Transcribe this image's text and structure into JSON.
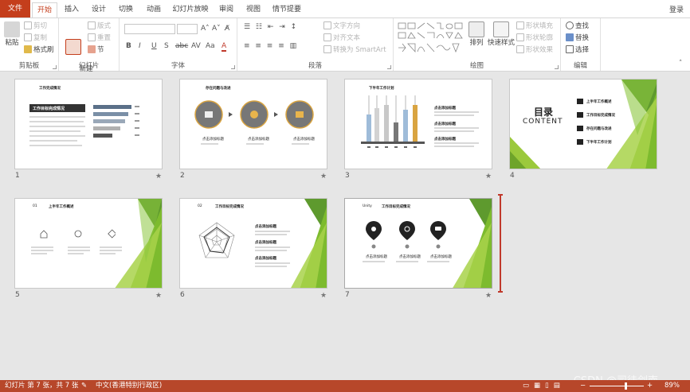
{
  "tabs": [
    "文件",
    "开始",
    "插入",
    "设计",
    "切换",
    "动画",
    "幻灯片放映",
    "审阅",
    "视图",
    "情节提要"
  ],
  "login": "登录",
  "ribbon": {
    "clipboard": {
      "paste": "粘贴",
      "cut": "剪切",
      "copy": "复制",
      "format_painter": "格式刷",
      "label": "剪贴板"
    },
    "slides": {
      "new_slide": "新建\n幻灯片",
      "layout": "版式",
      "reset": "重置",
      "section": "节",
      "label": "幻灯片"
    },
    "font": {
      "label": "字体",
      "buttons": [
        "B",
        "I",
        "U",
        "S",
        "abc",
        "AV",
        "Aa",
        "A"
      ]
    },
    "paragraph": {
      "text_direction": "文字方向",
      "align_text": "对齐文本",
      "smartart": "转换为 SmartArt",
      "label": "段落"
    },
    "drawing": {
      "arrange": "排列",
      "quick_styles": "快速样式",
      "shape_fill": "形状填充",
      "shape_outline": "形状轮廓",
      "shape_effects": "形状效果",
      "label": "绘图"
    },
    "editing": {
      "find": "查找",
      "replace": "替换",
      "select": "选择",
      "label": "编辑"
    }
  },
  "slides": [
    {
      "num": "1",
      "title": "工作完成情况",
      "subtitle": "工作目标完成情况"
    },
    {
      "num": "2",
      "title": "存在问题与改进",
      "captions": [
        "点击添加标题",
        "点击添加标题",
        "点击添加标题"
      ]
    },
    {
      "num": "3",
      "title": "下半年工作计划",
      "side_titles": [
        "点击添加标题",
        "点击添加标题",
        "点击添加标题"
      ]
    },
    {
      "num": "4",
      "toc_title": "目录",
      "toc_sub": "CONTENT",
      "items": [
        "上半年工作概述",
        "工作目标完成情况",
        "存在问题与改进",
        "下半年工作计划"
      ]
    },
    {
      "num": "5",
      "title": "上半年工作概述",
      "corner": "01"
    },
    {
      "num": "6",
      "title": "工作目标完成情况",
      "corner": "02",
      "side_titles": [
        "点击添加标题",
        "点击添加标题",
        "点击添加标题"
      ]
    },
    {
      "num": "7",
      "title": "工作目标完成情况",
      "corner": "Unity",
      "captions": [
        "点击添加标题",
        "点击添加标题",
        "点击添加标题"
      ]
    }
  ],
  "star": "★",
  "status": {
    "slide_info": "幻灯片 第 7 张，共 7 张",
    "language": "中文(香港特别行政区)",
    "zoom": "89%"
  },
  "watermark": "CSDN @司徒剑南",
  "colors": {
    "accent": "#c43e1c",
    "status_bar": "#b7472a",
    "green": "#7dbb2e"
  }
}
